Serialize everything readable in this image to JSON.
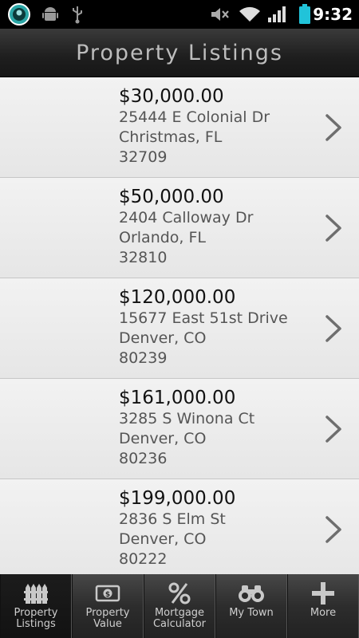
{
  "status_bar": {
    "time": "9:32",
    "icons": [
      "app-notification-icon",
      "android-debug-icon",
      "usb-icon",
      "mute-icon",
      "wifi-icon",
      "signal-icon",
      "battery-icon"
    ]
  },
  "header": {
    "title": "Property Listings"
  },
  "listings": [
    {
      "price": "$30,000.00",
      "street": "25444 E Colonial Dr",
      "city": "Christmas, FL",
      "zip": "32709"
    },
    {
      "price": "$50,000.00",
      "street": "2404 Calloway Dr",
      "city": "Orlando, FL",
      "zip": "32810"
    },
    {
      "price": "$120,000.00",
      "street": "15677 East 51st Drive",
      "city": "Denver, CO",
      "zip": "80239"
    },
    {
      "price": "$161,000.00",
      "street": "3285 S Winona Ct",
      "city": "Denver, CO",
      "zip": "80236"
    },
    {
      "price": "$199,000.00",
      "street": "2836 S Elm St",
      "city": "Denver, CO",
      "zip": "80222"
    }
  ],
  "tabs": [
    {
      "label": "Property\nListings",
      "icon": "fence-icon",
      "active": true
    },
    {
      "label": "Property\nValue",
      "icon": "dollar-bill-icon",
      "active": false
    },
    {
      "label": "Mortgage\nCalculator",
      "icon": "percent-icon",
      "active": false
    },
    {
      "label": "My Town",
      "icon": "binoculars-icon",
      "active": false
    },
    {
      "label": "More",
      "icon": "plus-icon",
      "active": false
    }
  ]
}
